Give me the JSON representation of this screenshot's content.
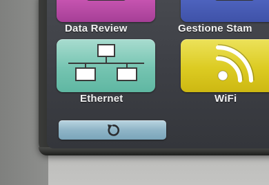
{
  "menu": {
    "tiles": [
      {
        "label": "Data Review",
        "icon": "data-review-icon",
        "color": "#c24fab"
      },
      {
        "label": "Gestione Stam",
        "icon": "print-management-icon",
        "color": "#4a5fbb"
      },
      {
        "label": "Ethernet",
        "icon": "ethernet-network-icon",
        "color": "#7ec8b6"
      },
      {
        "label": "WiFi",
        "icon": "wifi-icon",
        "color": "#e0d12e"
      }
    ]
  },
  "toolbar": {
    "refresh_icon": "refresh-icon",
    "refresh_color": "#8fb5c7"
  }
}
